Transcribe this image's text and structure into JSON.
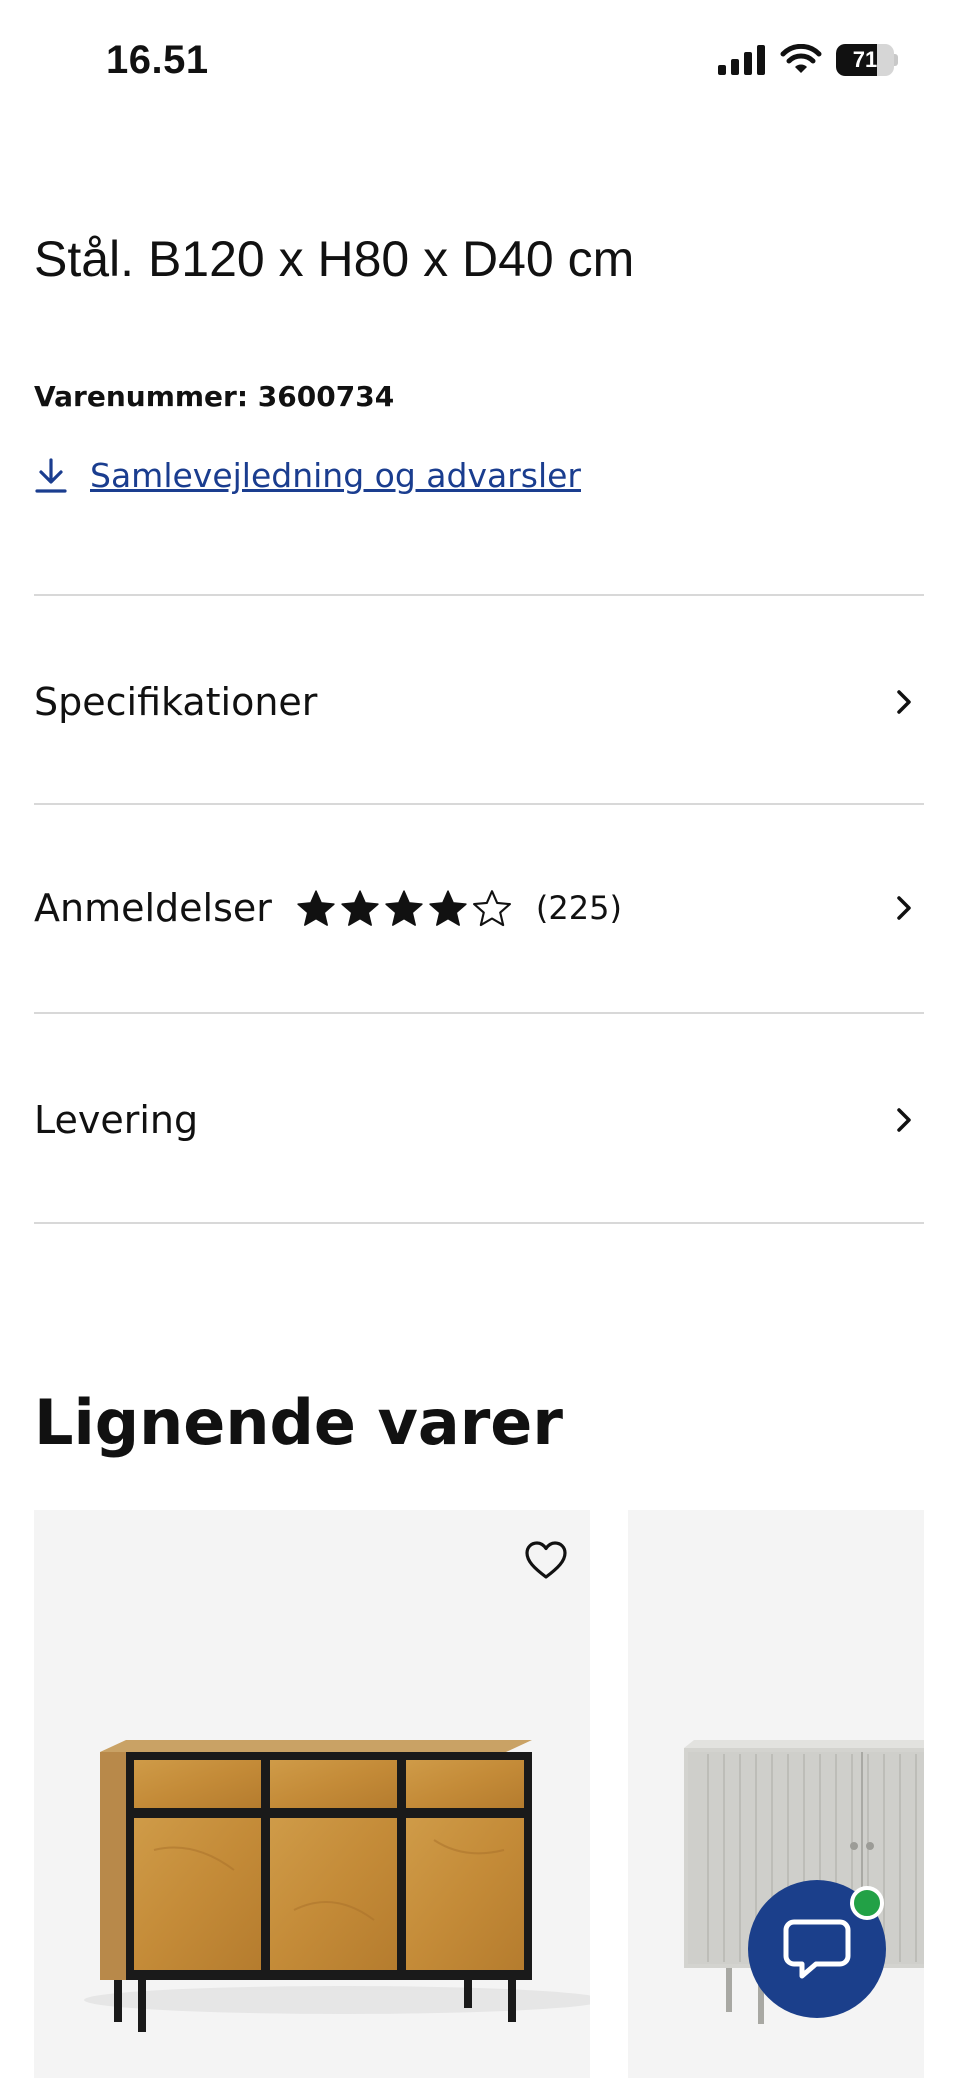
{
  "status_bar": {
    "time": "16.51",
    "battery": "71",
    "battery_level": 0.71
  },
  "product": {
    "title": "Stål. B120 x H80 x D40 cm",
    "sku": "Varenummer: 3600734",
    "manual_link": "Samlevejledning og advarsler"
  },
  "accordion": {
    "specifications": "Specifikationer",
    "reviews": "Anmeldelser",
    "review_count": "(225)",
    "rating": 4,
    "rating_max": 5,
    "delivery": "Levering"
  },
  "similar": {
    "heading": "Lignende varer"
  },
  "icons": {
    "download": "download-icon",
    "chevron": "chevron-right-icon",
    "star": "star-icon",
    "heart": "heart-icon",
    "chat": "chat-bubble-icon"
  },
  "colors": {
    "link": "#1a3d8f",
    "chat": "#1b3f8b",
    "online": "#22a146",
    "card_bg": "#f4f4f4"
  }
}
